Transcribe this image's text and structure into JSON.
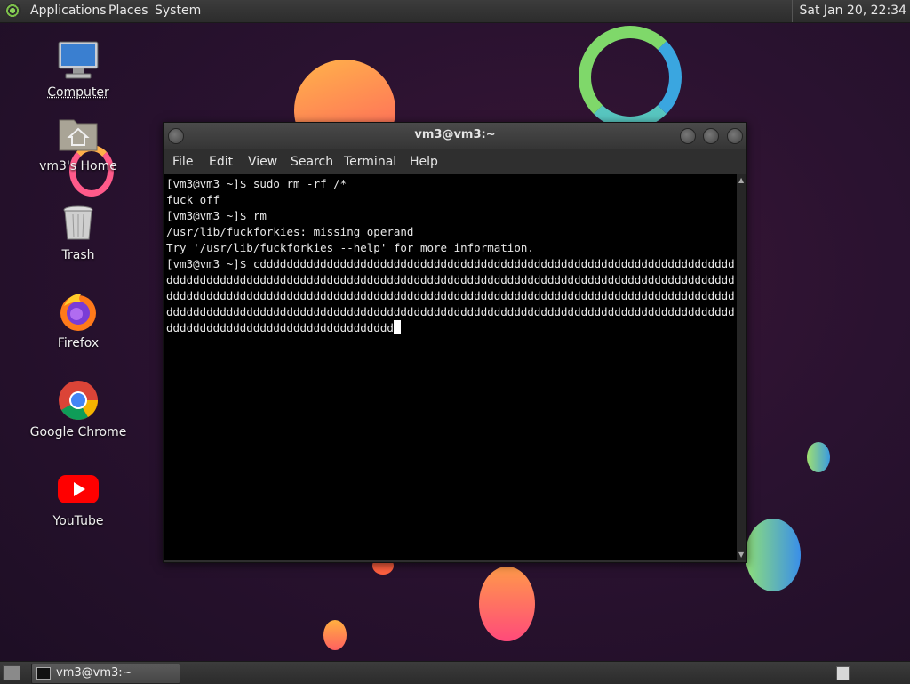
{
  "top_panel": {
    "menus": [
      "Applications",
      "Places",
      "System"
    ],
    "clock": "Sat Jan 20, 22:34"
  },
  "desktop": {
    "icons": [
      {
        "label": "Computer",
        "icon": "computer-icon"
      },
      {
        "label": "vm3's Home",
        "icon": "home-folder-icon"
      },
      {
        "label": "Trash",
        "icon": "trash-icon"
      },
      {
        "label": "Firefox",
        "icon": "firefox-icon"
      },
      {
        "label": "Google Chrome",
        "icon": "chrome-icon"
      },
      {
        "label": "YouTube",
        "icon": "youtube-icon"
      }
    ]
  },
  "terminal": {
    "title": "vm3@vm3:~",
    "menu": [
      "File",
      "Edit",
      "View",
      "Search",
      "Terminal",
      "Help"
    ],
    "output": "[vm3@vm3 ~]$ sudo rm -rf /*\nfuck off\n[vm3@vm3 ~]$ rm\n/usr/lib/fuckforkies: missing operand\nTry '/usr/lib/fuckforkies --help' for more information.\n[vm3@vm3 ~]$ cdddddddddddddddddddddddddddddddddddddddddddddddddddddddddddddddddddddddddddddddddddddddddddddddddddddddddddddddddddddddddddddddddddddddddddddddddddddddddddddddddddddddddddddddddddddddddddddddddddddddddddddddddddddddddddddddddddddddddddddddddddddddddddddddddddddddddddddddddddddddddddddddddddddddddddddddddddddddddddddddddddddddddddddddddddddddddddddddddddddddd"
  },
  "bottom_panel": {
    "task": "vm3@vm3:~"
  },
  "colors": {
    "panel": "#333333",
    "terminal_bg": "#000000",
    "terminal_fg": "#e8e8e8"
  }
}
